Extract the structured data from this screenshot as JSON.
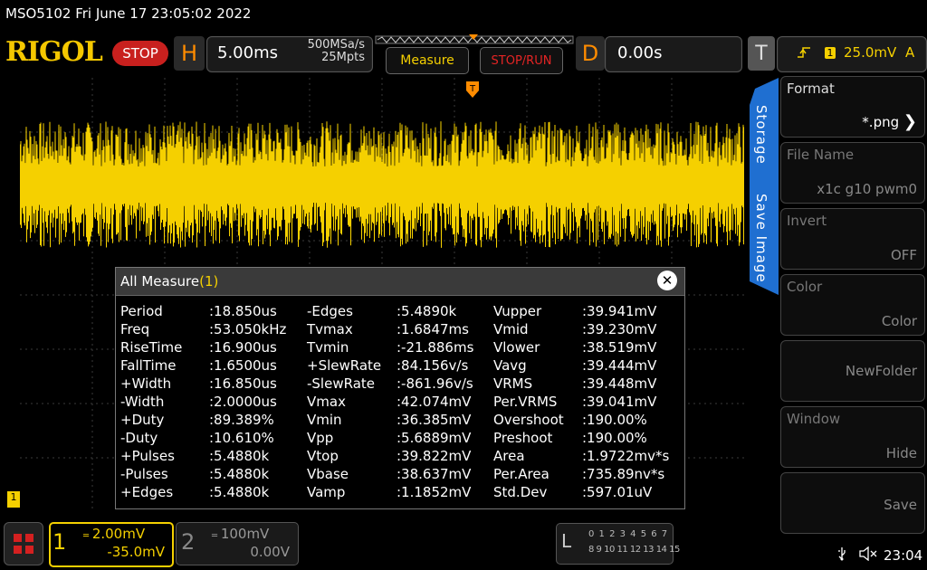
{
  "header": {
    "title": "MSO5102  Fri June 17 23:05:02 2022"
  },
  "toolbar": {
    "logo": "RIGOL",
    "run_state": "STOP",
    "horizontal_letter": "H",
    "timebase": "5.00ms",
    "sample_rate": "500MSa/s",
    "memory_depth": "25Mpts",
    "measure_label": "Measure",
    "stoprun_label": "STOP/RUN",
    "delay_letter": "D",
    "delay_value": "0.00s",
    "trigger_letter": "T",
    "trigger_source": "1",
    "trigger_level": "25.0mV",
    "trigger_mode": "A"
  },
  "side_menu": {
    "tabs": [
      "Storage",
      "Save Image"
    ],
    "items": [
      {
        "label": "Format",
        "value": "*.png"
      },
      {
        "label": "File Name",
        "value": "x1c g10 pwm0"
      },
      {
        "label": "Invert",
        "value": "OFF"
      },
      {
        "label": "Color",
        "value": "Color"
      },
      {
        "label": "",
        "value": "NewFolder"
      },
      {
        "label": "Window",
        "value": "Hide"
      },
      {
        "label": "",
        "value": "Save"
      }
    ]
  },
  "measure_panel": {
    "title": "All Measure",
    "count": "(1)",
    "columns": [
      [
        [
          "Period",
          ":18.850us"
        ],
        [
          "Freq",
          ":53.050kHz"
        ],
        [
          "RiseTime",
          ":16.900us"
        ],
        [
          "FallTime",
          ":1.6500us"
        ],
        [
          "+Width",
          ":16.850us"
        ],
        [
          "-Width",
          ":2.0000us"
        ],
        [
          "+Duty",
          ":89.389%"
        ],
        [
          "-Duty",
          ":10.610%"
        ],
        [
          "+Pulses",
          ":5.4880k"
        ],
        [
          "-Pulses",
          ":5.4880k"
        ],
        [
          "+Edges",
          ":5.4880k"
        ]
      ],
      [
        [
          "-Edges",
          ":5.4890k"
        ],
        [
          "Tvmax",
          ":1.6847ms"
        ],
        [
          "Tvmin",
          ":-21.886ms"
        ],
        [
          "+SlewRate",
          ":84.156v/s"
        ],
        [
          "-SlewRate",
          ":-861.96v/s"
        ],
        [
          "Vmax",
          ":42.074mV"
        ],
        [
          "Vmin",
          ":36.385mV"
        ],
        [
          "Vpp",
          ":5.6889mV"
        ],
        [
          "Vtop",
          ":39.822mV"
        ],
        [
          "Vbase",
          ":38.637mV"
        ],
        [
          "Vamp",
          ":1.1852mV"
        ]
      ],
      [
        [
          "Vupper",
          ":39.941mV"
        ],
        [
          "Vmid",
          ":39.230mV"
        ],
        [
          "Vlower",
          ":38.519mV"
        ],
        [
          "Vavg",
          ":39.444mV"
        ],
        [
          "VRMS",
          ":39.448mV"
        ],
        [
          "Per.VRMS",
          ":39.041mV"
        ],
        [
          "Overshoot",
          ":190.00%"
        ],
        [
          "Preshoot",
          ":190.00%"
        ],
        [
          "Area",
          ":1.9722mv*s"
        ],
        [
          "Per.Area",
          ":735.89nv*s"
        ],
        [
          "Std.Dev",
          ":597.01uV"
        ]
      ]
    ]
  },
  "channels": {
    "ch1": {
      "number": "1",
      "scale": "2.00mV",
      "offset": "-35.0mV",
      "marker": "1"
    },
    "ch2": {
      "number": "2",
      "scale": "100mV",
      "offset": "0.00V"
    }
  },
  "logic_analyzer": {
    "letter": "L",
    "row1": "0 1 2 3   4 5 6 7",
    "row2": "8 9 10 11 12 13 14 15"
  },
  "status": {
    "clock": "23:04"
  },
  "colors": {
    "ch1": "#f5d000",
    "accent_blue": "#1f6fd1",
    "stop_red": "#c8201e",
    "orange": "#ff8c00"
  }
}
